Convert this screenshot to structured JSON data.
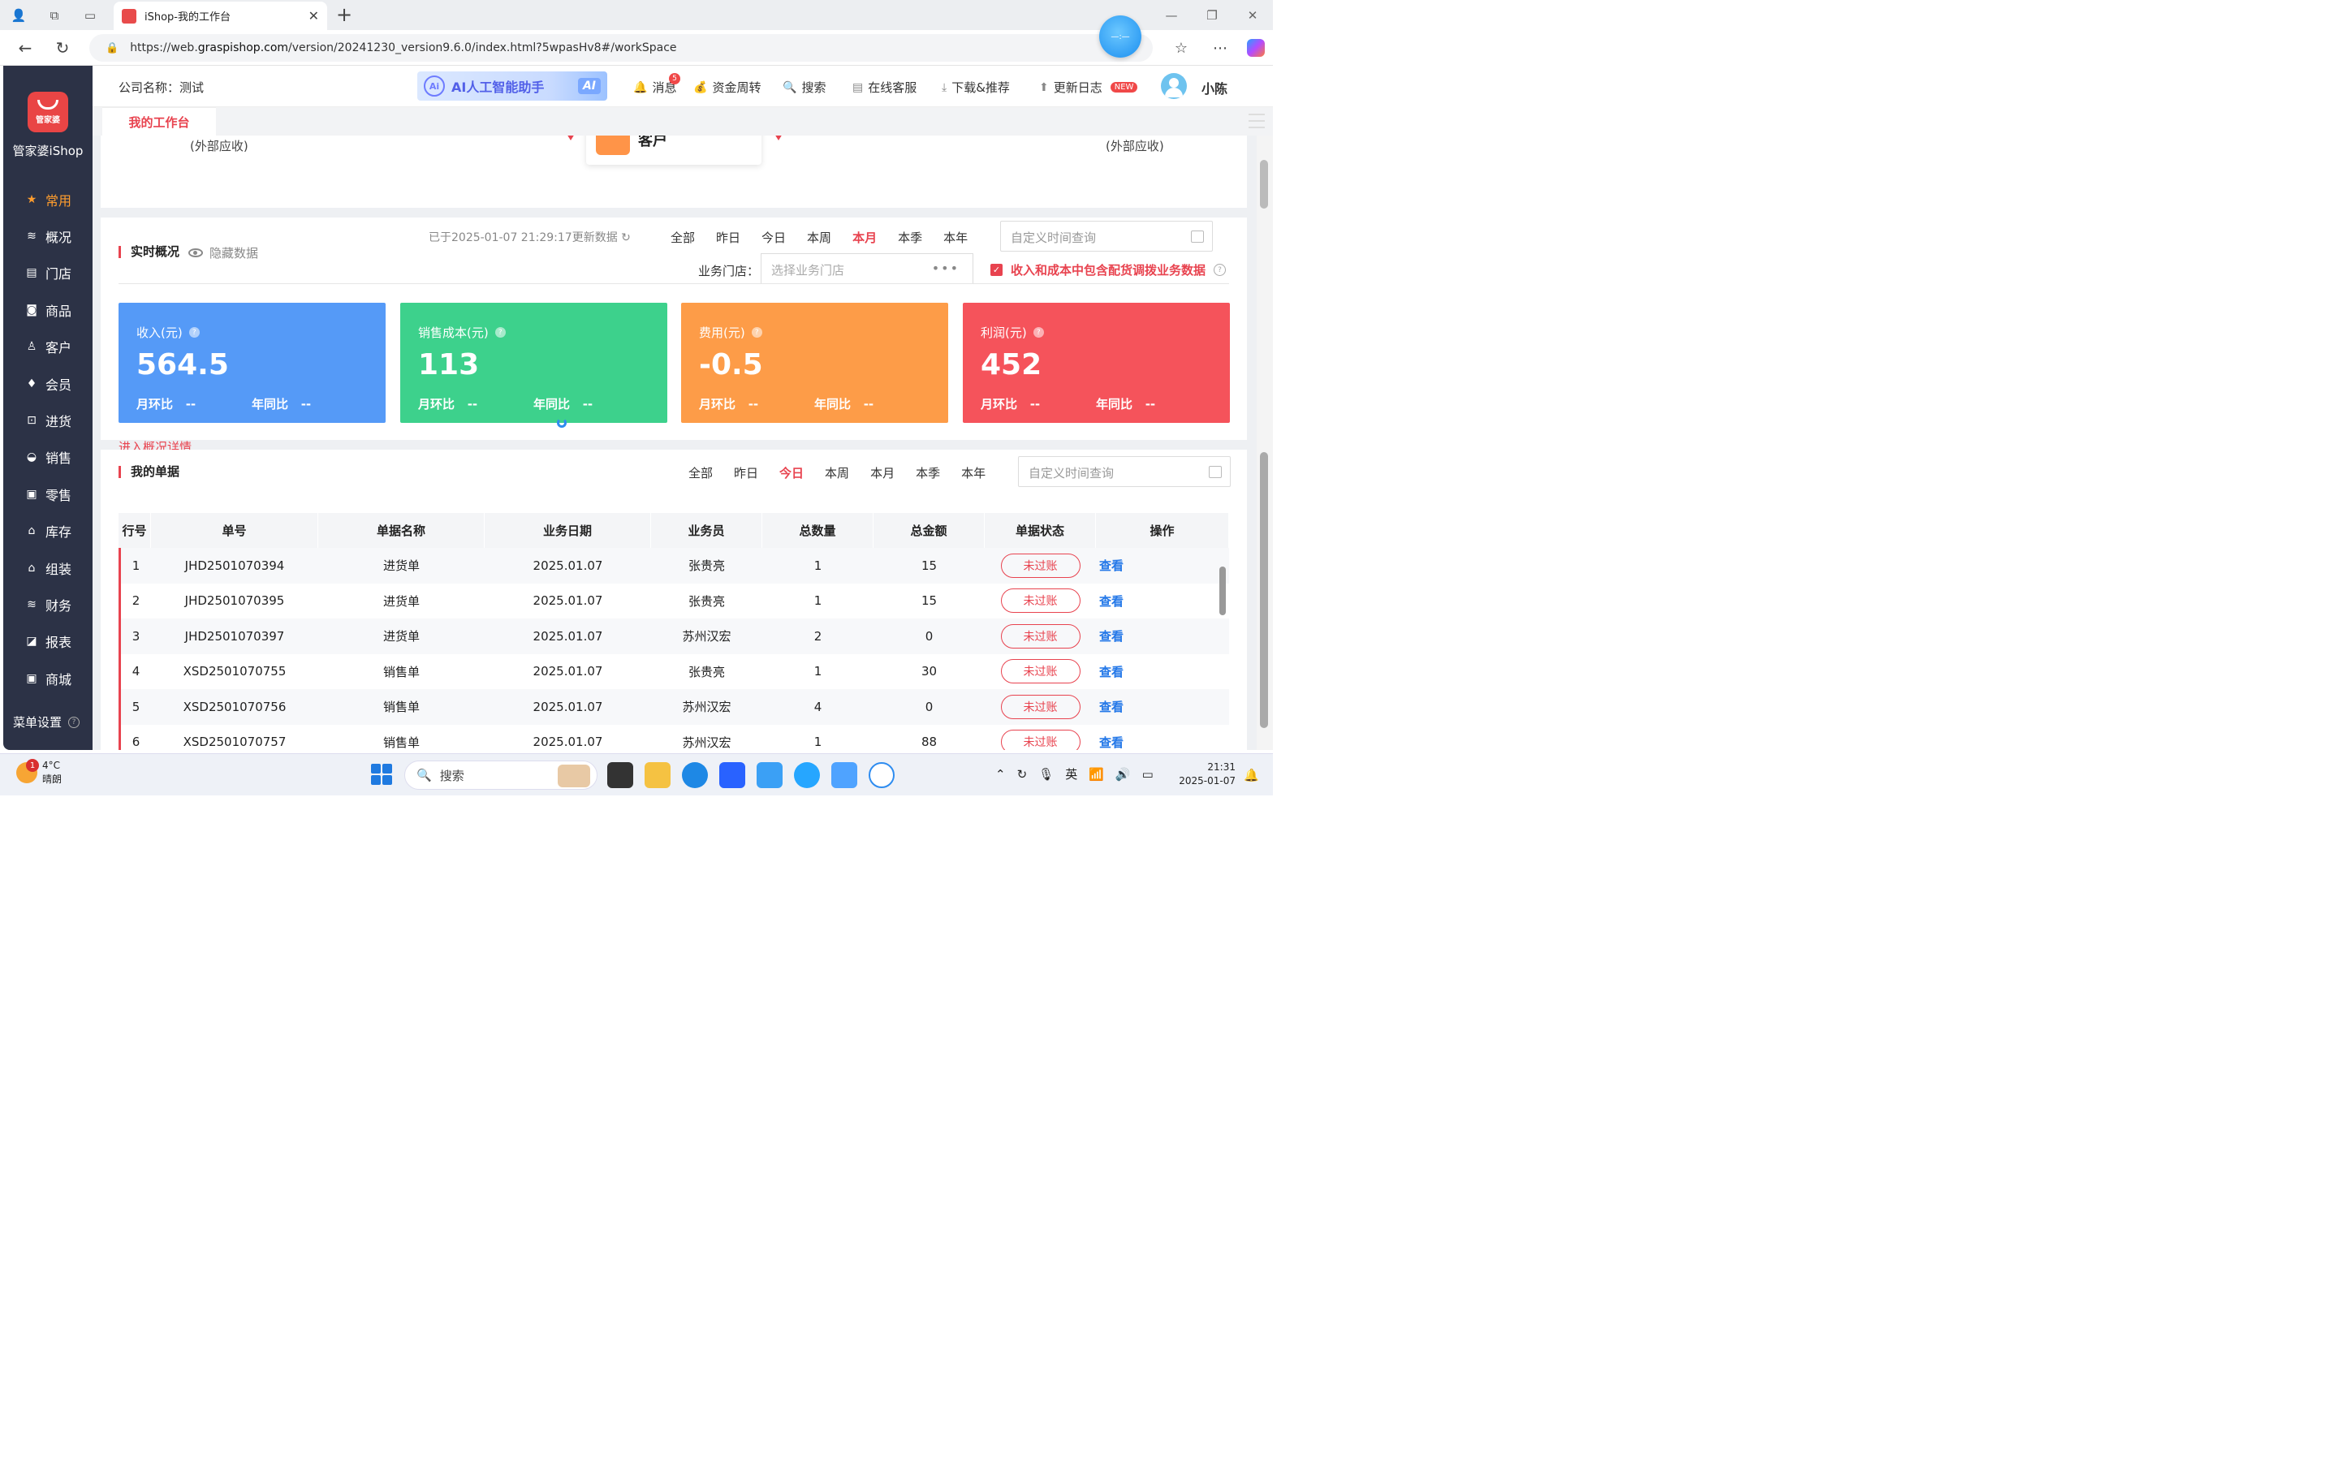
{
  "browser": {
    "tab_title": "iShop-我的工作台",
    "url_prefix": "https://web.",
    "url_domain": "graspishop.com",
    "url_rest": "/version/20241230_version9.6.0/index.html?5wpasHv8#/workSpace",
    "ball_text": "—:—"
  },
  "sidebar": {
    "logo_text": "管家婆",
    "brand": "管家婆iShop",
    "items": [
      {
        "label": "常用",
        "icon": "star-icon",
        "glyph": "★"
      },
      {
        "label": "概况",
        "icon": "layers-icon",
        "glyph": "≋"
      },
      {
        "label": "门店",
        "icon": "store-icon",
        "glyph": "▤"
      },
      {
        "label": "商品",
        "icon": "bag-icon",
        "glyph": "◙"
      },
      {
        "label": "客户",
        "icon": "user-icon",
        "glyph": "♙"
      },
      {
        "label": "会员",
        "icon": "diamond-icon",
        "glyph": "♦"
      },
      {
        "label": "进货",
        "icon": "cart-icon",
        "glyph": "⊡"
      },
      {
        "label": "销售",
        "icon": "basket-icon",
        "glyph": "◒"
      },
      {
        "label": "零售",
        "icon": "register-icon",
        "glyph": "▣"
      },
      {
        "label": "库存",
        "icon": "warehouse-icon",
        "glyph": "⌂"
      },
      {
        "label": "组装",
        "icon": "assemble-icon",
        "glyph": "⌂"
      },
      {
        "label": "财务",
        "icon": "finance-icon",
        "glyph": "≋"
      },
      {
        "label": "报表",
        "icon": "report-icon",
        "glyph": "◪"
      },
      {
        "label": "商城",
        "icon": "mall-icon",
        "glyph": "▣"
      }
    ],
    "menu_settings": "菜单设置"
  },
  "header": {
    "company": "公司名称：测试",
    "ai_title": "AI人工智能助手",
    "ai_badge": "AI",
    "messages": "消息",
    "messages_count": "5",
    "funds": "资金周转",
    "search": "搜索",
    "service": "在线客服",
    "download": "下载&推荐",
    "changelog": "更新日志",
    "new_tag": "NEW",
    "user": "小陈"
  },
  "tabs": {
    "workspace": "我的工作台"
  },
  "top_card": {
    "ext_left": "(外部应收)",
    "ext_right": "(外部应收)",
    "customer": "客户"
  },
  "overview": {
    "title": "实时概况",
    "hide": "隐藏数据",
    "updated": "已于2025-01-07 21:29:17更新数据",
    "filters": [
      "全部",
      "昨日",
      "今日",
      "本周",
      "本月",
      "本季",
      "本年"
    ],
    "active_filter": "本月",
    "date_placeholder": "自定义时间查询",
    "store_label": "业务门店：",
    "store_placeholder": "选择业务门店",
    "include_label": "收入和成本中包含配货调拨业务数据",
    "mom": "月环比",
    "yoy": "年同比",
    "dash": "--",
    "stats": [
      {
        "label": "收入(元)",
        "value": "564.5",
        "color": "#559af7"
      },
      {
        "label": "销售成本(元)",
        "value": "113",
        "color": "#3dd18c"
      },
      {
        "label": "费用(元)",
        "value": "-0.5",
        "color": "#fd9c48"
      },
      {
        "label": "利润(元)",
        "value": "452",
        "color": "#f5535b"
      }
    ],
    "detail_link": "进入概况详情"
  },
  "documents": {
    "title": "我的单据",
    "filters": [
      "全部",
      "昨日",
      "今日",
      "本周",
      "本月",
      "本季",
      "本年"
    ],
    "active_filter": "今日",
    "date_placeholder": "自定义时间查询",
    "columns": [
      "行号",
      "单号",
      "单据名称",
      "业务日期",
      "业务员",
      "总数量",
      "总金额",
      "单据状态",
      "操作"
    ],
    "rows": [
      [
        "1",
        "JHD2501070394",
        "进货单",
        "2025.01.07",
        "张贵亮",
        "1",
        "15",
        "未过账",
        "查看"
      ],
      [
        "2",
        "JHD2501070395",
        "进货单",
        "2025.01.07",
        "张贵亮",
        "1",
        "15",
        "未过账",
        "查看"
      ],
      [
        "3",
        "JHD2501070397",
        "进货单",
        "2025.01.07",
        "苏州汉宏",
        "2",
        "0",
        "未过账",
        "查看"
      ],
      [
        "4",
        "XSD2501070755",
        "销售单",
        "2025.01.07",
        "张贵亮",
        "1",
        "30",
        "未过账",
        "查看"
      ],
      [
        "5",
        "XSD2501070756",
        "销售单",
        "2025.01.07",
        "苏州汉宏",
        "4",
        "0",
        "未过账",
        "查看"
      ],
      [
        "6",
        "XSD2501070757",
        "销售单",
        "2025.01.07",
        "苏州汉宏",
        "1",
        "88",
        "未过账",
        "查看"
      ]
    ]
  },
  "taskbar": {
    "temp": "4°C",
    "weather": "晴朗",
    "weather_badge": "1",
    "search": "搜索",
    "lang": "英",
    "time": "21:31",
    "date": "2025-01-07"
  }
}
